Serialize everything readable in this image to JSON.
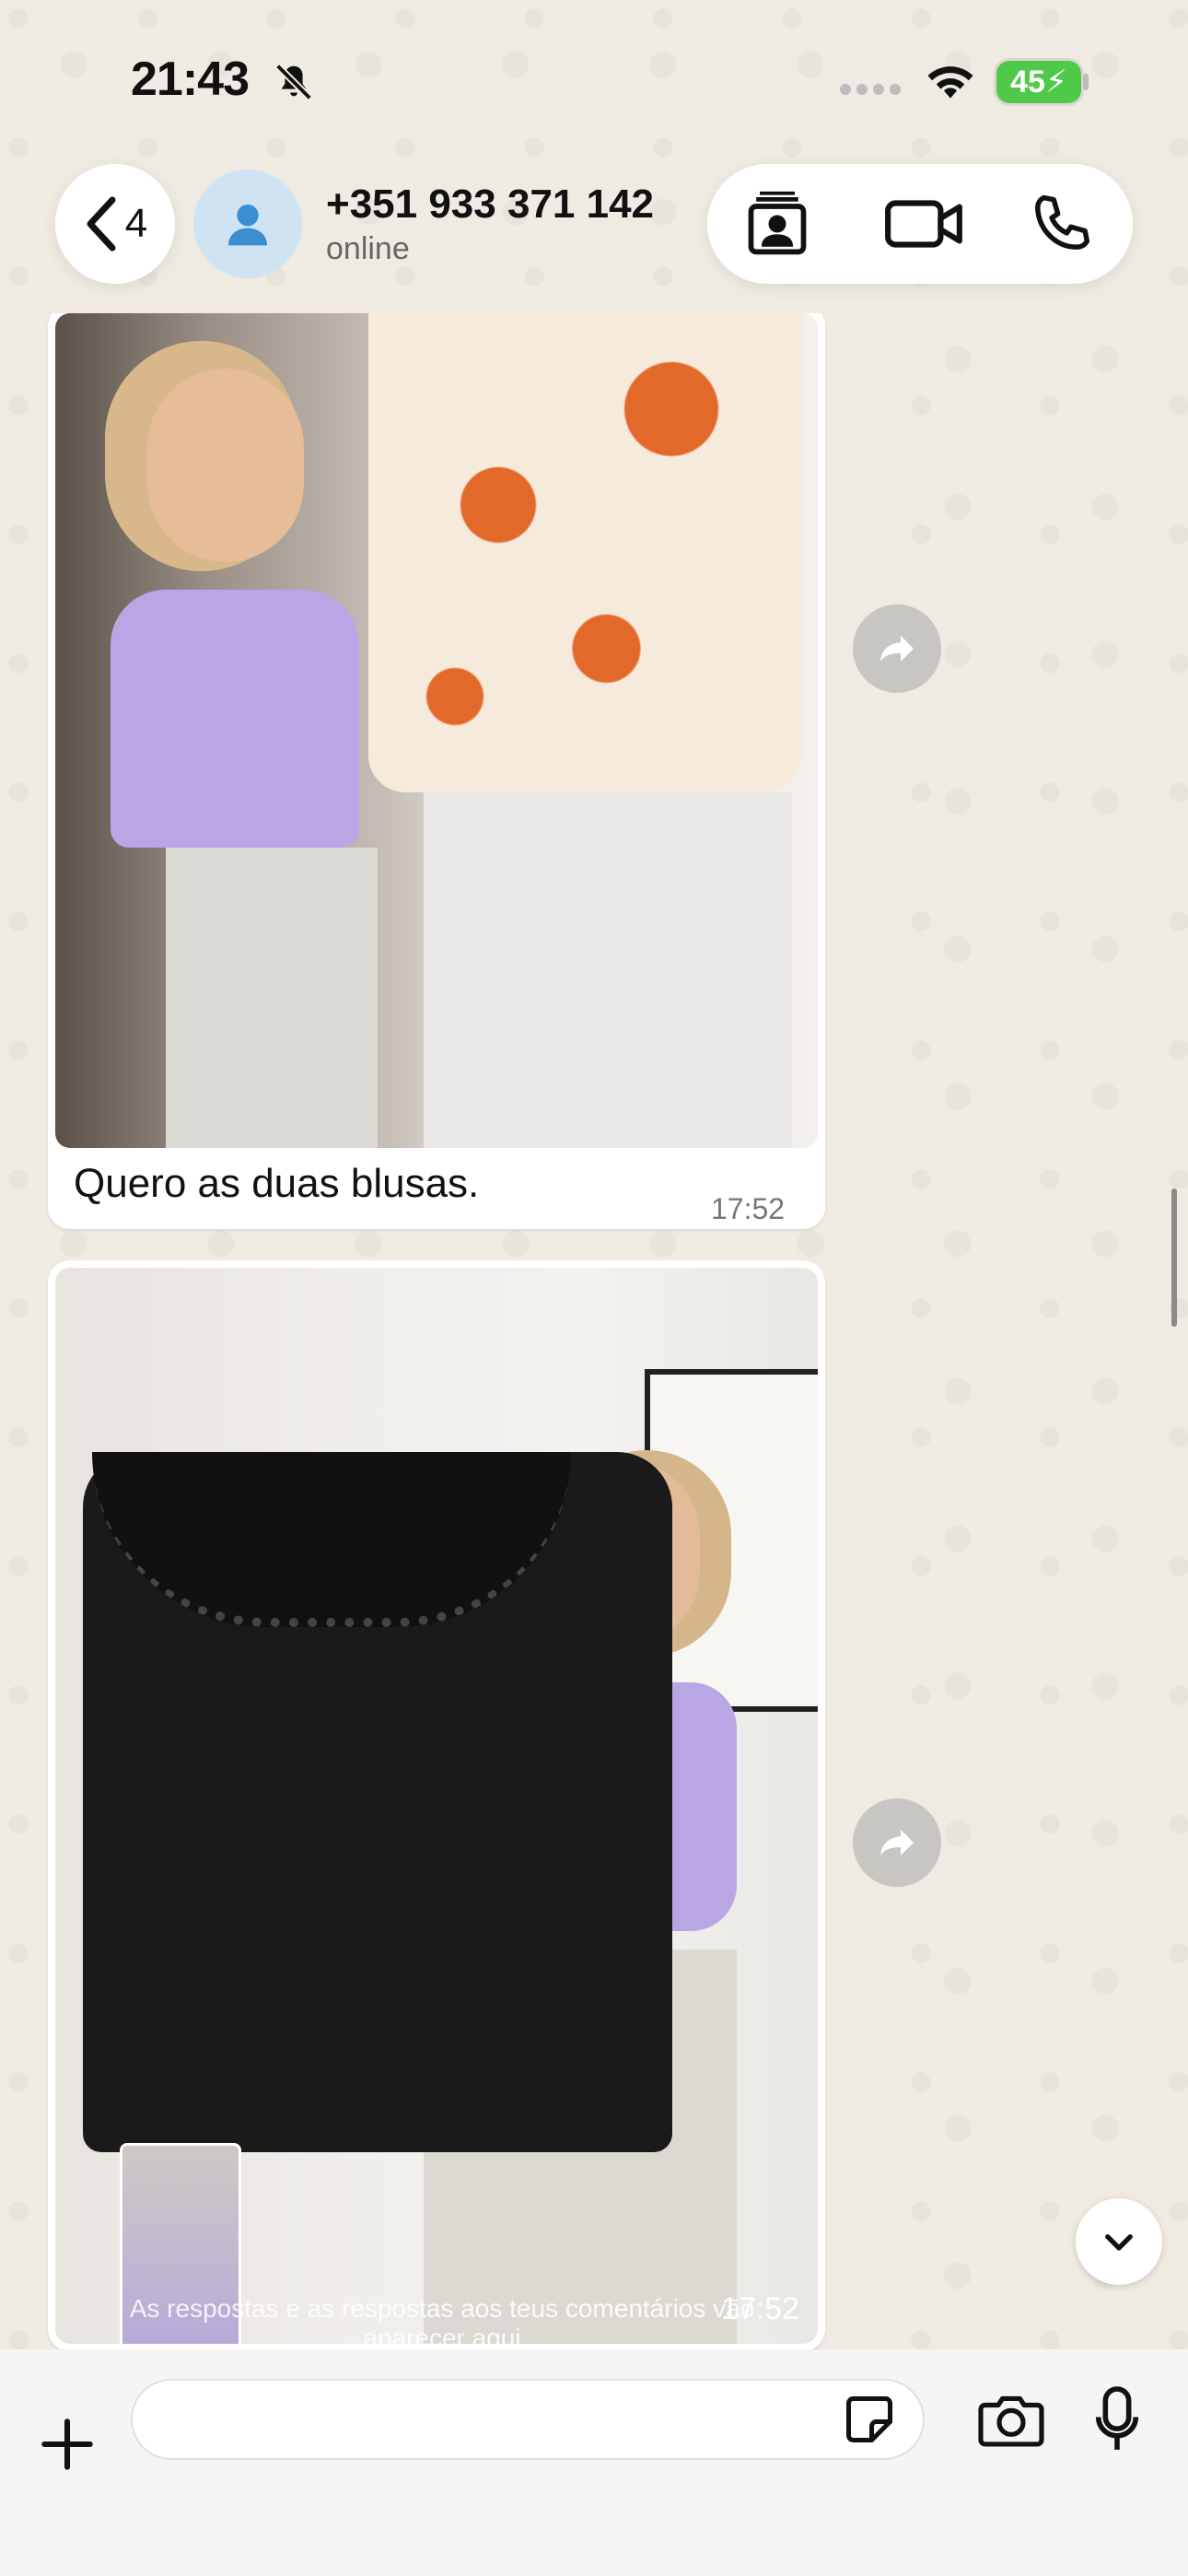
{
  "status_bar": {
    "time": "21:43",
    "battery": "45"
  },
  "header": {
    "back_count": "4",
    "contact_name": "+351 933 371 142",
    "contact_status": "online"
  },
  "messages": [
    {
      "type": "image",
      "caption": "Quero as duas blusas.",
      "time": "17:52"
    },
    {
      "type": "video",
      "overlay_text": "As respostas e as respostas aos teus comentários vão aparecer aqui",
      "time": "17:52"
    }
  ],
  "input": {
    "placeholder": ""
  },
  "colors": {
    "accent": "#25D366",
    "bubble": "#ffffff",
    "battery": "#4fc94a"
  }
}
